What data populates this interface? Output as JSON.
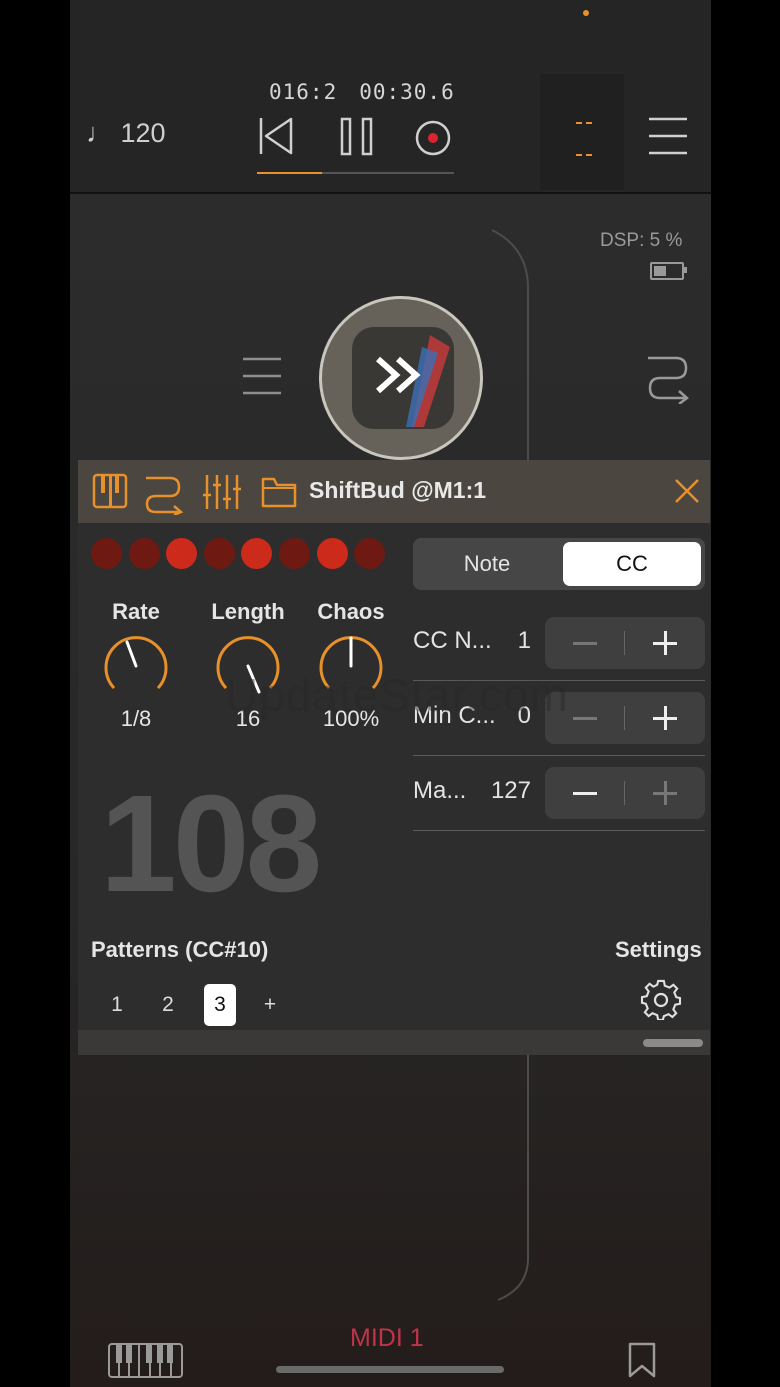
{
  "transport": {
    "tempo": "120",
    "position": "016:2",
    "time": "00:30.6",
    "progress": 0.33
  },
  "status": {
    "dsp_label": "DSP:",
    "dsp_value": "5 %"
  },
  "panel": {
    "title": "ShiftBud @M1:1",
    "step_dots": [
      false,
      false,
      true,
      false,
      true,
      false,
      true,
      false
    ],
    "knobs": [
      {
        "label": "Rate",
        "value": "1/8"
      },
      {
        "label": "Length",
        "value": "16"
      },
      {
        "label": "Chaos",
        "value": "100%"
      }
    ],
    "current_value": "108",
    "mode_tabs": {
      "note": "Note",
      "cc": "CC",
      "selected": "CC"
    },
    "params": [
      {
        "label": "CC N...",
        "value": "1"
      },
      {
        "label": "Min C...",
        "value": "0"
      },
      {
        "label": "Ma...",
        "value": "127"
      }
    ],
    "patterns_title": "Patterns (CC#10)",
    "patterns": [
      "1",
      "2",
      "3",
      "+"
    ],
    "active_pattern": "3",
    "settings_label": "Settings"
  },
  "watermark": "UpdateStar.com",
  "bottom": {
    "channel": "MIDI 1"
  },
  "colors": {
    "accent": "#e8902a",
    "dot_on": "#cc2a1a",
    "dot_off": "#6e1a12",
    "midi_label": "#c2334a"
  },
  "icons": [
    "note-icon",
    "skip-back-icon",
    "pause-icon",
    "record-icon",
    "menu-icon",
    "routing-icon",
    "keyboard-icon",
    "mixer-icon",
    "folder-icon",
    "close-icon",
    "gear-icon",
    "bookmark-icon",
    "battery-icon"
  ]
}
